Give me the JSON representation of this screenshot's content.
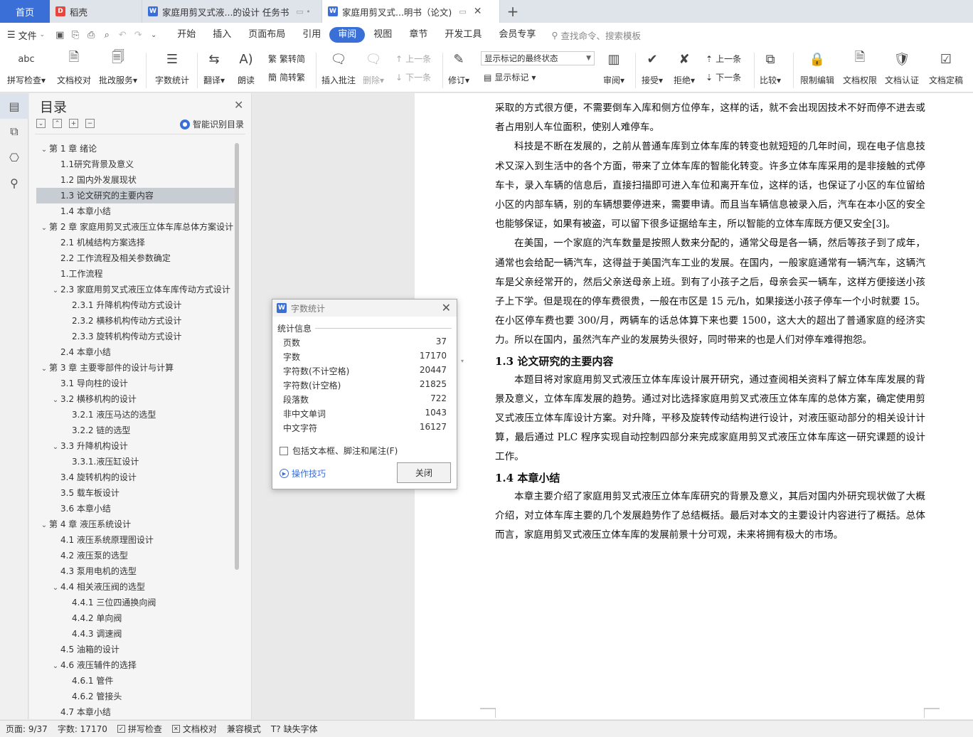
{
  "tabs": {
    "home": "首页",
    "items": [
      {
        "label": "稻壳",
        "icon": "docer-icon"
      },
      {
        "label": "家庭用剪叉式液...的设计 任务书",
        "icon": "wps-writer-icon"
      },
      {
        "label": "家庭用剪叉式...明书（论文)",
        "icon": "wps-writer-icon"
      }
    ],
    "new_tab": "+"
  },
  "menu": {
    "file": "文件",
    "items": [
      "开始",
      "插入",
      "页面布局",
      "引用",
      "审阅",
      "视图",
      "章节",
      "开发工具",
      "会员专享"
    ],
    "active": "审阅",
    "search": "查找命令、搜索模板"
  },
  "ribbon": {
    "spellcheck": "拼写检查",
    "proofread": "文档校对",
    "batch_service": "批改服务",
    "word_count": "字数统计",
    "translate": "翻译",
    "read_aloud": "朗读",
    "trad_simplified": "繁转简",
    "simplified_trad": "简转繁",
    "insert_comment": "插入批注",
    "delete": "删除",
    "prev_comment": "上一条",
    "next_comment": "下一条",
    "revise": "修订",
    "markup_mode": "显示标记的最终状态",
    "show_markup": "显示标记",
    "review": "审阅",
    "accept": "接受",
    "reject": "拒绝",
    "prev_change": "上一条",
    "next_change": "下一条",
    "compare": "比较",
    "restrict_edit": "限制编辑",
    "doc_permission": "文档权限",
    "doc_certify": "文档认证",
    "doc_finalize": "文档定稿"
  },
  "toc": {
    "title": "目录",
    "smart": "智能识别目录",
    "items": [
      {
        "text": "第 1 章  绪论",
        "level": 0,
        "arrow": "⌄"
      },
      {
        "text": "1.1研究背景及意义",
        "level": 1
      },
      {
        "text": "1.2 国内外发展现状",
        "level": 1
      },
      {
        "text": "1.3 论文研究的主要内容",
        "level": 1,
        "selected": true
      },
      {
        "text": "1.4 本章小结",
        "level": 1
      },
      {
        "text": "第 2 章  家庭用剪叉式液压立体车库总体方案设计",
        "level": 0,
        "arrow": "⌄"
      },
      {
        "text": "2.1 机械结构方案选择",
        "level": 1
      },
      {
        "text": "2.2 工作流程及相关参数确定",
        "level": 1
      },
      {
        "text": "1.工作流程",
        "level": 1
      },
      {
        "text": "2.3 家庭用剪叉式液压立体车库传动方式设计",
        "level": 1,
        "arrow": "⌄"
      },
      {
        "text": "2.3.1 升降机构传动方式设计",
        "level": 2
      },
      {
        "text": "2.3.2 横移机构传动方式设计",
        "level": 2
      },
      {
        "text": "2.3.3 旋转机构传动方式设计",
        "level": 2
      },
      {
        "text": "2.4 本章小结",
        "level": 1
      },
      {
        "text": "第 3 章  主要零部件的设计与计算",
        "level": 0,
        "arrow": "⌄"
      },
      {
        "text": "3.1 导向柱的设计",
        "level": 1
      },
      {
        "text": "3.2 横移机构的设计",
        "level": 1,
        "arrow": "⌄"
      },
      {
        "text": "3.2.1 液压马达的选型",
        "level": 2
      },
      {
        "text": "3.2.2 链的选型",
        "level": 2
      },
      {
        "text": "3.3 升降机构设计",
        "level": 1,
        "arrow": "⌄"
      },
      {
        "text": "3.3.1.液压缸设计",
        "level": 2
      },
      {
        "text": "3.4 旋转机构的设计",
        "level": 1
      },
      {
        "text": "3.5  载车板设计",
        "level": 1
      },
      {
        "text": "3.6 本章小结",
        "level": 1
      },
      {
        "text": "第 4 章  液压系统设计",
        "level": 0,
        "arrow": "⌄"
      },
      {
        "text": "4.1 液压系统原理图设计",
        "level": 1
      },
      {
        "text": "4.2 液压泵的选型",
        "level": 1
      },
      {
        "text": "4.3 泵用电机的选型",
        "level": 1
      },
      {
        "text": "4.4 相关液压阀的选型",
        "level": 1,
        "arrow": "⌄"
      },
      {
        "text": "4.4.1 三位四通换向阀",
        "level": 2
      },
      {
        "text": "4.4.2 单向阀",
        "level": 2
      },
      {
        "text": "4.4.3 调速阀",
        "level": 2
      },
      {
        "text": "4.5 油箱的设计",
        "level": 1
      },
      {
        "text": "4.6 液压辅件的选择",
        "level": 1,
        "arrow": "⌄"
      },
      {
        "text": "4.6.1 管件",
        "level": 2
      },
      {
        "text": "4.6.2 管接头",
        "level": 2
      },
      {
        "text": "4.7 本章小结",
        "level": 1
      }
    ]
  },
  "document": {
    "blocks": [
      {
        "type": "p",
        "indent": false,
        "text": "采取的方式很方便，不需要倒车入库和侧方位停车，这样的话，就不会出现因技术不好而停不进去或者占用别人车位面积，使别人难停车。"
      },
      {
        "type": "p",
        "indent": true,
        "text": "科技是不断在发展的，之前从普通车库到立体车库的转变也就短短的几年时间，现在电子信息技术又深入到生活中的各个方面，带来了立体车库的智能化转变。许多立体车库采用的是非接触的式停车卡，录入车辆的信息后，直接扫描即可进入车位和离开车位，这样的话，也保证了小区的车位留给小区的内部车辆，别的车辆想要停进来，需要申请。而且当车辆信息被录入后，汽车在本小区的安全也能够保证，如果有被盗，可以留下很多证据给车主，所以智能的立体车库既方便又安全[3]。"
      },
      {
        "type": "p",
        "indent": true,
        "text": "在美国，一个家庭的汽车数量是按照人数来分配的，通常父母是各一辆，然后等孩子到了成年，通常也会给配一辆汽车，这得益于美国汽车工业的发展。在国内，一般家庭通常有一辆汽车，这辆汽车是父亲经常开的，然后父亲送母亲上班。到有了小孩子之后，母亲会买一辆车，这样方便接送小孩子上下学。但是现在的停车费很贵，一般在市区是 15 元/h，如果接送小孩子停车一个小时就要 15。在小区停车费也要 300/月，两辆车的话总体算下来也要 1500，这大大的超出了普通家庭的经济实力。所以在国内，虽然汽车产业的发展势头很好，同时带来的也是人们对停车难得抱怨。"
      },
      {
        "type": "h",
        "text": "1.3 论文研究的主要内容"
      },
      {
        "type": "p",
        "indent": true,
        "text": "本题目将对家庭用剪叉式液压立体车库设计展开研究，通过查阅相关资料了解立体车库发展的背景及意义，立体车库发展的趋势。通过对比选择家庭用剪叉式液压立体车库的总体方案，确定使用剪叉式液压立体车库设计方案。对升降，平移及旋转传动结构进行设计，对液压驱动部分的相关设计计算，最后通过 PLC 程序实现自动控制四部分来完成家庭用剪叉式液压立体车库这一研究课题的设计工作。"
      },
      {
        "type": "h",
        "text": "1.4 本章小结"
      },
      {
        "type": "p",
        "indent": true,
        "text": "本章主要介绍了家庭用剪叉式液压立体车库研究的背景及意义，其后对国内外研究现状做了大概介绍，对立体车库主要的几个发展趋势作了总结概括。最后对本文的主要设计内容进行了概括。总体而言，家庭用剪叉式液压立体车库的发展前景十分可观，未来将拥有极大的市场。"
      }
    ]
  },
  "dialog": {
    "title": "字数统计",
    "section": "统计信息",
    "stats": [
      {
        "label": "页数",
        "value": "37"
      },
      {
        "label": "字数",
        "value": "17170"
      },
      {
        "label": "字符数(不计空格)",
        "value": "20447"
      },
      {
        "label": "字符数(计空格)",
        "value": "21825"
      },
      {
        "label": "段落数",
        "value": "722"
      },
      {
        "label": "非中文单词",
        "value": "1043"
      },
      {
        "label": "中文字符",
        "value": "16127"
      }
    ],
    "checkbox": "包括文本框、脚注和尾注(F)",
    "tips": "操作技巧",
    "close": "关闭"
  },
  "status": {
    "page": "页面: 9/37",
    "words": "字数: 17170",
    "spell": "拼写检查",
    "proof": "文档校对",
    "compat": "兼容模式",
    "missing_font": "缺失字体"
  },
  "colors": {
    "accent": "#3b6fd8",
    "tabbar": "#dfe3ea",
    "docer": "#e8453c"
  }
}
